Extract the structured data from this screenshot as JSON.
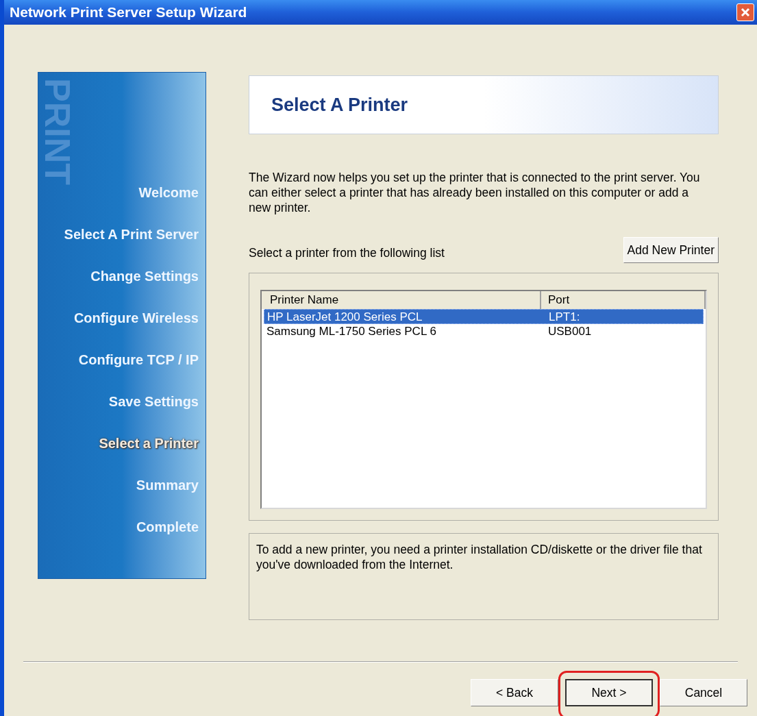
{
  "window": {
    "title": "Network Print Server Setup Wizard"
  },
  "sidebar": {
    "watermark": "PRINT",
    "items": [
      {
        "label": "Welcome",
        "selected": false
      },
      {
        "label": "Select A Print Server",
        "selected": false
      },
      {
        "label": "Change Settings",
        "selected": false
      },
      {
        "label": "Configure Wireless",
        "selected": false
      },
      {
        "label": "Configure TCP / IP",
        "selected": false
      },
      {
        "label": "Save Settings",
        "selected": false
      },
      {
        "label": "Select a Printer",
        "selected": true
      },
      {
        "label": "Summary",
        "selected": false
      },
      {
        "label": "Complete",
        "selected": false
      }
    ]
  },
  "header": {
    "title": "Select A Printer"
  },
  "intro": "The Wizard now helps you set up the printer that is connected to the print server. You can either select a printer that has already been installed on this computer or add a new printer.",
  "list_label": "Select a printer from the following list",
  "add_button": "Add New Printer",
  "table": {
    "columns": [
      "Printer Name",
      "Port"
    ],
    "rows": [
      {
        "cells": [
          "HP LaserJet 1200 Series PCL",
          "LPT1:"
        ],
        "selected": true
      },
      {
        "cells": [
          "Samsung ML-1750 Series PCL 6",
          "USB001"
        ],
        "selected": false
      }
    ]
  },
  "note": "To add a new printer, you need a printer installation CD/diskette or the driver file that you've downloaded from the Internet.",
  "buttons": [
    {
      "label": "< Back",
      "highlighted": false
    },
    {
      "label": "Next >",
      "highlighted": true
    },
    {
      "label": "Cancel",
      "highlighted": false
    }
  ]
}
